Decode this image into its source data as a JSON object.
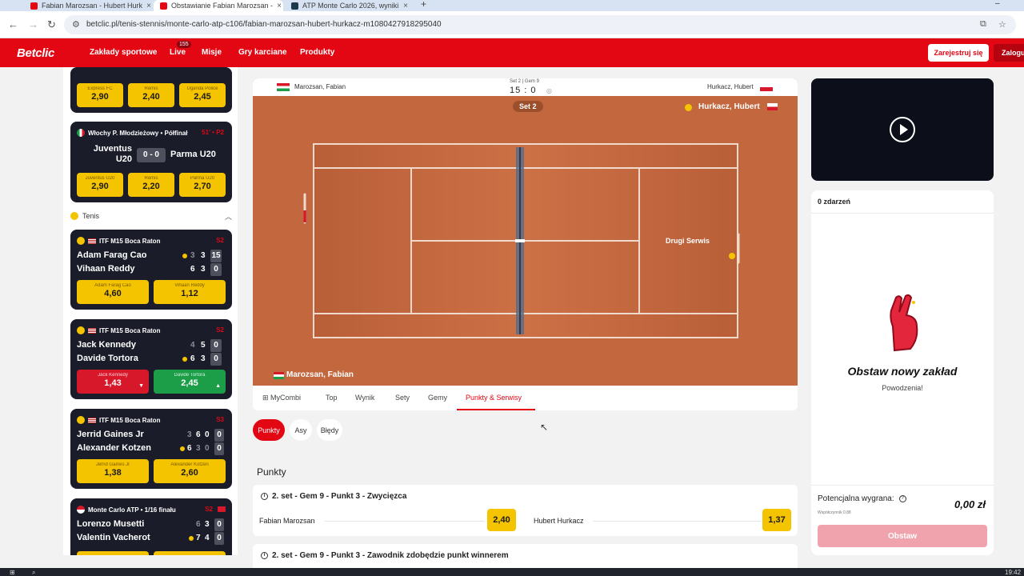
{
  "browser": {
    "tabs": [
      {
        "title": "Fabian Marozsan - Hubert Hurk"
      },
      {
        "title": "Obstawianie Fabian Marozsan - "
      },
      {
        "title": "ATP Monte Carlo 2026, wyniki"
      }
    ],
    "url": "betclic.pl/tenis-stennis/monte-carlo-atp-c106/fabian-marozsan-hubert-hurkacz-m1080427918295040"
  },
  "header": {
    "logo": "Betclic",
    "nav": [
      "Zakłady sportowe",
      "Live",
      "Misje",
      "Gry karciane",
      "Produkty"
    ],
    "live_count": "155",
    "register": "Zarejestruj się",
    "login": "Zaloguj"
  },
  "sidebar": {
    "card0": {
      "odds": [
        {
          "label": "Express FC",
          "value": "2,90"
        },
        {
          "label": "Remis",
          "value": "2,40"
        },
        {
          "label": "Uganda Police",
          "value": "2,45"
        }
      ]
    },
    "card1": {
      "league": "Włochy P. Młodzieżowy • Półfinał",
      "time": "51' • P2",
      "home": "Juventus U20",
      "score": "0 - 0",
      "away": "Parma U20",
      "odds": [
        {
          "label": "Juventus U20",
          "value": "2,90"
        },
        {
          "label": "Remis",
          "value": "2,20"
        },
        {
          "label": "Parma U20",
          "value": "2,70"
        }
      ]
    },
    "tenis_label": "Tenis",
    "matches": [
      {
        "league": "ITF M15 Boca Raton",
        "set": "S2",
        "p1": "Adam Farag Cao",
        "p2": "Vihaan Reddy",
        "p1s": [
          "3",
          "3",
          "15"
        ],
        "p2s": [
          "6",
          "3",
          "0"
        ],
        "odds": [
          {
            "label": "Adam Farag Cao",
            "value": "4,60"
          },
          {
            "label": "Vihaan Reddy",
            "value": "1,12"
          }
        ]
      },
      {
        "league": "ITF M15 Boca Raton",
        "set": "S2",
        "p1": "Jack Kennedy",
        "p2": "Davide Tortora",
        "p1s": [
          "4",
          "5",
          "0"
        ],
        "p2s": [
          "6",
          "3",
          "0"
        ],
        "odds": [
          {
            "label": "Jack Kennedy",
            "value": "1,43"
          },
          {
            "label": "Davide Tortora",
            "value": "2,45"
          }
        ]
      },
      {
        "league": "ITF M15 Boca Raton",
        "set": "S3",
        "p1": "Jerrid Gaines Jr",
        "p2": "Alexander Kotzen",
        "p1s": [
          "3",
          "6",
          "0",
          "0"
        ],
        "p2s": [
          "6",
          "3",
          "0",
          "0"
        ],
        "odds": [
          {
            "label": "Jerrid Gaines Jr",
            "value": "1,38"
          },
          {
            "label": "Alexander Kotzen",
            "value": "2,60"
          }
        ]
      },
      {
        "league": "Monte Carlo ATP • 1/16 finału",
        "set": "S2",
        "p1": "Lorenzo Musetti",
        "p2": "Valentin Vacherot",
        "p1s": [
          "6",
          "3",
          "0"
        ],
        "p2s": [
          "7",
          "4",
          "0"
        ]
      }
    ]
  },
  "match": {
    "p1_short": "Marozsan, Fabian",
    "p2_short": "Hurkacz, Hubert",
    "score_label": "Set 2 | Gem 9",
    "score": "15 : 0",
    "set_pill": "Set 2",
    "p2_court": "Hurkacz, Hubert",
    "p1_court": "Marozsan, Fabian",
    "court_event": "Drugi Serwis"
  },
  "tabs": [
    "MyCombi",
    "Top",
    "Wynik",
    "Sety",
    "Gemy",
    "Punkty & Serwisy"
  ],
  "chips": [
    "Punkty",
    "Asy",
    "Błędy"
  ],
  "section_title": "Punkty",
  "markets": [
    {
      "title": "2. set - Gem 9 - Punkt 3 - Zwycięzca",
      "sel1": "Fabian Marozsan",
      "odd1": "2,40",
      "sel2": "Hubert Hurkacz",
      "odd2": "1,37"
    },
    {
      "title": "2. set - Gem 9 - Punkt 3 - Zawodnik zdobędzie punkt winnerem"
    }
  ],
  "slip": {
    "count": "0 zdarzeń",
    "title": "Obstaw nowy zakład",
    "subtitle": "Powodzenia!",
    "potential_label": "Potencjalna wygrana:",
    "potential_value": "0,00 zł",
    "coef": "Współczynnik 0.88",
    "button": "Obstaw"
  },
  "taskbar": {
    "time": "19:42"
  }
}
